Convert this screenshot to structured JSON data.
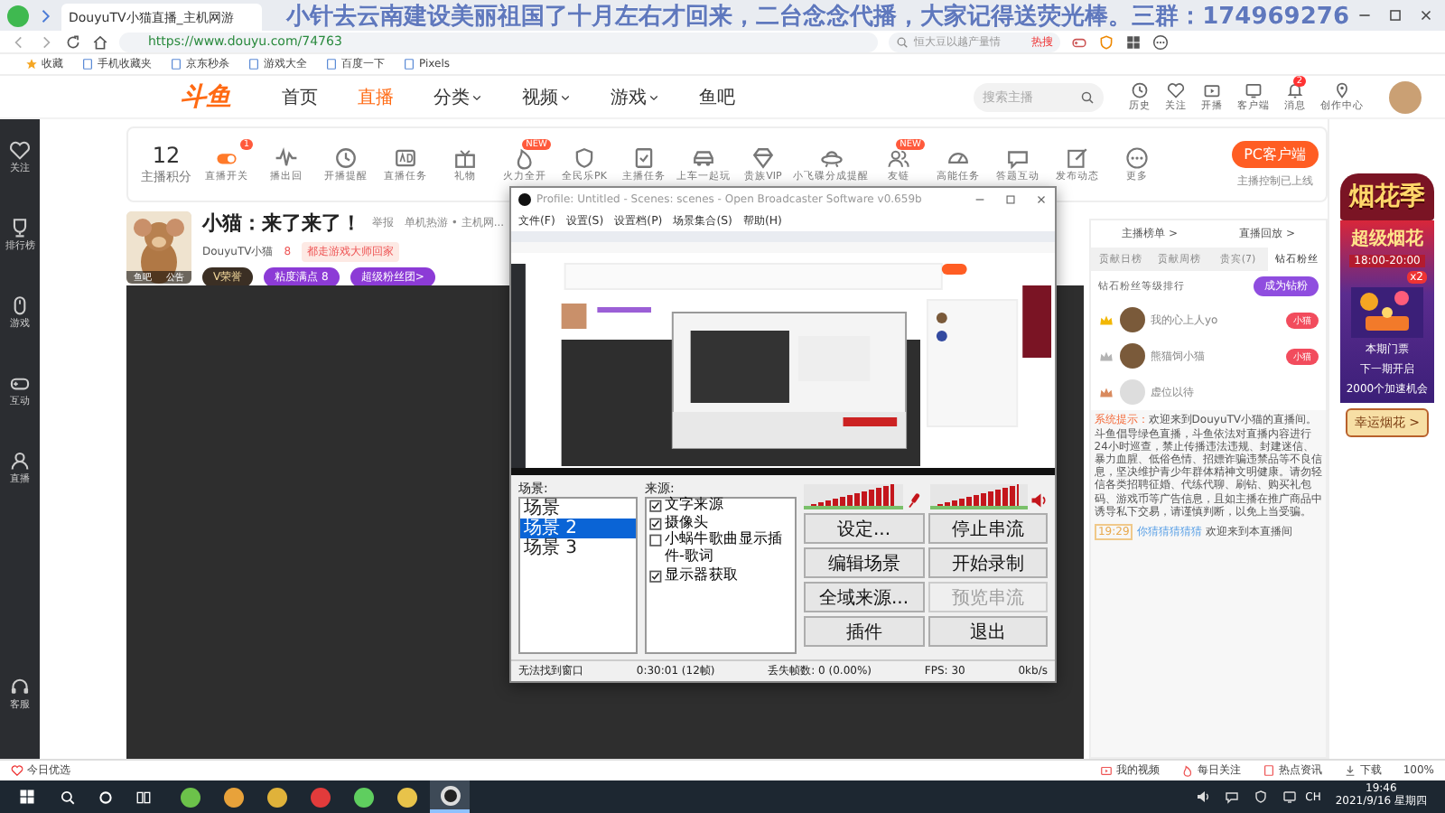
{
  "browser": {
    "tab_title": "DouyuTV小猫直播_主机网游",
    "overlay_text": "小针去云南建设美丽祖国了十月左右才回来，二台念念代播，大家记得送荧光棒。三群：174969276",
    "url": "https://www.douyu.com/74763",
    "search_placeholder": "恒大豆以越产量情",
    "hot_label": "热搜",
    "bookmarks": [
      "收藏",
      "手机收藏夹",
      "京东秒杀",
      "游戏大全",
      "百度一下",
      "Pixels"
    ]
  },
  "site_header": {
    "logo": "斗鱼",
    "nav": [
      {
        "label": "首页",
        "selected": false,
        "dropdown": false
      },
      {
        "label": "直播",
        "selected": true,
        "dropdown": false
      },
      {
        "label": "分类",
        "selected": false,
        "dropdown": true
      },
      {
        "label": "视频",
        "selected": false,
        "dropdown": true
      },
      {
        "label": "游戏",
        "selected": false,
        "dropdown": true
      },
      {
        "label": "鱼吧",
        "selected": false,
        "dropdown": false
      }
    ],
    "search_placeholder": "搜索主播",
    "actions": [
      {
        "label": "历史"
      },
      {
        "label": "关注"
      },
      {
        "label": "开播"
      },
      {
        "label": "客户端"
      },
      {
        "label": "消息",
        "badge": "2"
      },
      {
        "label": "创作中心"
      }
    ]
  },
  "side_nav": {
    "items": [
      {
        "label": "关注"
      },
      {
        "label": "排行榜"
      },
      {
        "label": "游戏"
      },
      {
        "label": "互动"
      },
      {
        "label": "直播"
      }
    ],
    "bottom": {
      "label": "客服"
    }
  },
  "toolbar": {
    "score": {
      "value": "12",
      "label": "主播积分"
    },
    "items": [
      {
        "label": "直播开关",
        "badge": "1"
      },
      {
        "label": "播出回"
      },
      {
        "label": "开播提醒"
      },
      {
        "label": "直播任务"
      },
      {
        "label": "礼物"
      },
      {
        "label": "火力全开",
        "badge": "NEW"
      },
      {
        "label": "全民乐PK"
      },
      {
        "label": "主播任务"
      },
      {
        "label": "上车一起玩"
      },
      {
        "label": "贵族VIP"
      },
      {
        "label": "小飞碟分成提醒"
      },
      {
        "label": "友链",
        "badge": "NEW"
      },
      {
        "label": "高能任务"
      },
      {
        "label": "答题互动"
      },
      {
        "label": "发布动态"
      },
      {
        "label": "更多"
      }
    ],
    "pc_button": "PC客户端",
    "pc_note": "主播控制已上线"
  },
  "streamer": {
    "title": "小猫：来了来了！",
    "report": "举报",
    "category": "单机热游 • 主机网...",
    "name": "DouyuTV小猫",
    "heat": "8",
    "tag": "都走游戏大师回家",
    "avatar_links": [
      "鱼吧",
      "公告"
    ],
    "badges": [
      "V荣誉",
      "粘度满点 8",
      "超级粉丝团>"
    ]
  },
  "obs": {
    "title": "Profile: Untitled - Scenes: scenes - Open Broadcaster Software v0.659b",
    "menu": [
      "文件(F)",
      "设置(S)",
      "设置档(P)",
      "场景集合(S)",
      "帮助(H)"
    ],
    "scenes_label": "场景:",
    "scenes": [
      {
        "name": "场景",
        "selected": false
      },
      {
        "name": "场景 2",
        "selected": true
      },
      {
        "name": "场景 3",
        "selected": false
      }
    ],
    "sources_label": "来源:",
    "sources": [
      {
        "name": "文字来源",
        "checked": true
      },
      {
        "name": "摄像头",
        "checked": true
      },
      {
        "name": "小蜗牛歌曲显示插件-歌词",
        "checked": false
      },
      {
        "name": "显示器获取",
        "checked": true
      }
    ],
    "meters": [
      {
        "kind": "microphone",
        "level": 0.92
      },
      {
        "kind": "speaker",
        "level": 0.9
      }
    ],
    "buttons": [
      {
        "label": "设定...",
        "disabled": false
      },
      {
        "label": "停止串流",
        "disabled": false
      },
      {
        "label": "编辑场景",
        "disabled": false
      },
      {
        "label": "开始录制",
        "disabled": false
      },
      {
        "label": "全域来源...",
        "disabled": false
      },
      {
        "label": "预览串流",
        "disabled": true
      },
      {
        "label": "插件",
        "disabled": false
      },
      {
        "label": "退出",
        "disabled": false
      }
    ],
    "status": [
      "无法找到窗口",
      "0:30:01 (12帧)",
      "丢失帧数: 0 (0.00%)",
      "FPS: 30",
      "0kb/s"
    ]
  },
  "chat_panel": {
    "links": [
      "主播榜单 >",
      "直播回放 >"
    ],
    "tabs": [
      {
        "label": "贡献日榜",
        "selected": false
      },
      {
        "label": "贡献周榜",
        "selected": false
      },
      {
        "label": "贵宾(7)",
        "selected": false
      },
      {
        "label": "钻石粉丝",
        "selected": true
      }
    ],
    "rank_title": "钻石粉丝等级排行",
    "join_button": "成为钻粉",
    "ranks": [
      {
        "name": "我的心上人yo",
        "badge": "小猫",
        "color": "#f2b705"
      },
      {
        "name": "熊猫饲小猫",
        "badge": "小猫",
        "color": "#b4b4b4"
      },
      {
        "name": "虚位以待",
        "color": "#d98a5e"
      }
    ],
    "system": {
      "label": "系统提示：",
      "text": "欢迎来到DouyuTV小猫的直播间。斗鱼倡导绿色直播，斗鱼依法对直播内容进行24小时巡查，禁止传播违法违规、封建迷信、暴力血腥、低俗色情、招嫖诈骗违禁品等不良信息，坚决维护青少年群体精神文明健康。请勿轻信各类招聘征婚、代练代聊、刷钻、购买礼包码、游戏币等广告信息，且如主播在推广商品中诱导私下交易，请谨慎判断，以免上当受骗。"
    },
    "entry": {
      "time": "19:29",
      "user": "你猜猜猜猜猜",
      "text": "欢迎来到本直播间"
    }
  },
  "promo": {
    "title": "烟花季",
    "event": "超级烟花",
    "time": "18:00-20:00",
    "multiplier": "x2",
    "ticket": "本期门票",
    "next": "下一期开启",
    "chance": "2000个加速机会",
    "button": "幸运烟花 >"
  },
  "status_bar": {
    "left": "今日优选",
    "items": [
      "我的视频",
      "每日关注",
      "热点资讯",
      "下载",
      "100%"
    ]
  },
  "taskbar": {
    "apps": [
      {
        "selected": false
      },
      {
        "selected": false
      },
      {
        "selected": false
      },
      {
        "selected": false
      },
      {
        "selected": false
      },
      {
        "selected": false
      },
      {
        "selected": true
      }
    ],
    "ime": "CH",
    "time": "19:46",
    "date": "2021/9/16 星期四"
  }
}
